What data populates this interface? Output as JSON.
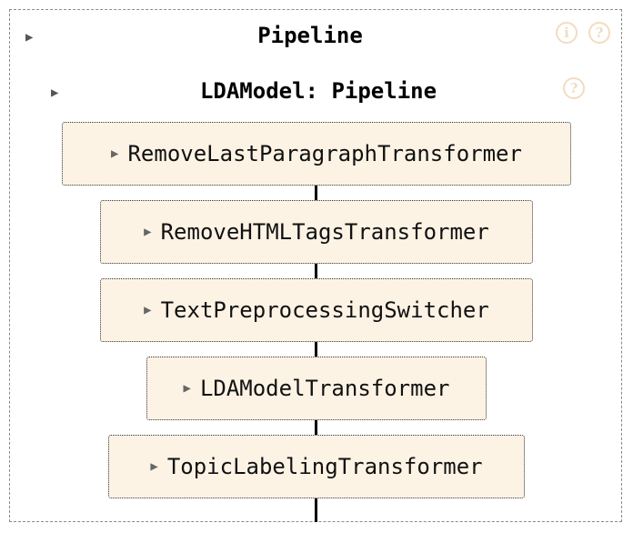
{
  "pipeline": {
    "title": "Pipeline",
    "toggle": "▶",
    "info_glyph": "i",
    "help_glyph": "?"
  },
  "sub_pipeline": {
    "title": "LDAModel: Pipeline",
    "toggle": "▶",
    "help_glyph": "?"
  },
  "steps": [
    {
      "label": "RemoveLastParagraphTransformer",
      "toggle": "▶"
    },
    {
      "label": "RemoveHTMLTagsTransformer",
      "toggle": "▶"
    },
    {
      "label": "TextPreprocessingSwitcher",
      "toggle": "▶"
    },
    {
      "label": "LDAModelTransformer",
      "toggle": "▶"
    },
    {
      "label": "TopicLabelingTransformer",
      "toggle": "▶"
    }
  ],
  "colors": {
    "step_fill": "#fdf3e5",
    "icon": "#f2dcc0",
    "connector": "#000000"
  }
}
